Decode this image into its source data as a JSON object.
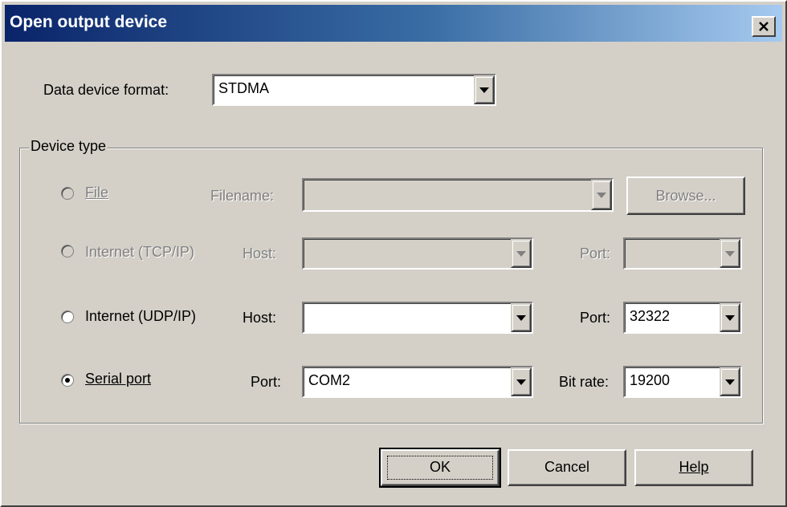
{
  "window": {
    "title": "Open output device",
    "close_label": "×"
  },
  "format": {
    "label": "Data device format:",
    "value": "STDMA"
  },
  "device_type": {
    "legend": "Device type",
    "file": {
      "label": "File",
      "filename_label": "Filename:",
      "filename_value": "",
      "browse_label": "Browse..."
    },
    "tcp": {
      "label": "Internet (TCP/IP)",
      "host_label": "Host:",
      "host_value": "",
      "port_label": "Port:",
      "port_value": ""
    },
    "udp": {
      "label": "Internet (UDP/IP)",
      "host_label": "Host:",
      "host_value": "",
      "port_label": "Port:",
      "port_value": "32322"
    },
    "serial": {
      "label": "Serial port",
      "port_label": "Port:",
      "port_value": "COM2",
      "bitrate_label": "Bit rate:",
      "bitrate_value": "19200",
      "selected": true
    }
  },
  "buttons": {
    "ok": "OK",
    "cancel": "Cancel",
    "help": "Help"
  }
}
